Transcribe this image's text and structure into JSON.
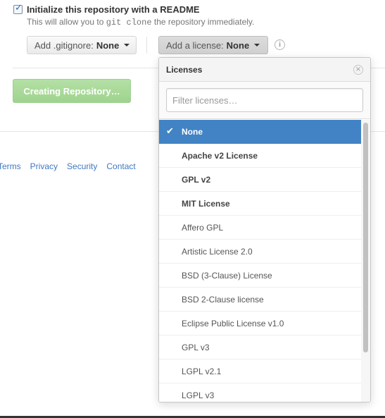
{
  "readme": {
    "label": "Initialize this repository with a README",
    "help_prefix": "This will allow you to",
    "help_code": "git clone",
    "help_suffix": "the repository immediately.",
    "checked": true
  },
  "gitignore": {
    "label": "Add .gitignore:",
    "value": "None"
  },
  "license": {
    "label": "Add a license:",
    "value": "None"
  },
  "create_button": "Creating Repository…",
  "footer": {
    "links": [
      "Terms",
      "Privacy",
      "Security",
      "Contact"
    ]
  },
  "licenses_dropdown": {
    "title": "Licenses",
    "filter_placeholder": "Filter licenses…",
    "items": [
      {
        "label": "None",
        "selected": true,
        "bold": true
      },
      {
        "label": "Apache v2 License",
        "bold": true
      },
      {
        "label": "GPL v2",
        "bold": true
      },
      {
        "label": "MIT License",
        "bold": true
      },
      {
        "label": "Affero GPL"
      },
      {
        "label": "Artistic License 2.0"
      },
      {
        "label": "BSD (3-Clause) License"
      },
      {
        "label": "BSD 2-Clause license"
      },
      {
        "label": "Eclipse Public License v1.0"
      },
      {
        "label": "GPL v3"
      },
      {
        "label": "LGPL v2.1"
      },
      {
        "label": "LGPL v3"
      }
    ]
  },
  "icons": {
    "check": "checkbox-check-icon",
    "info": "info-icon",
    "close": "close-icon",
    "caret": "caret-down-icon",
    "selected_mark": "checkmark-icon"
  },
  "colors": {
    "selected_row": "#4183c4",
    "create_button": "#9fd38e",
    "link": "#4078c0"
  }
}
